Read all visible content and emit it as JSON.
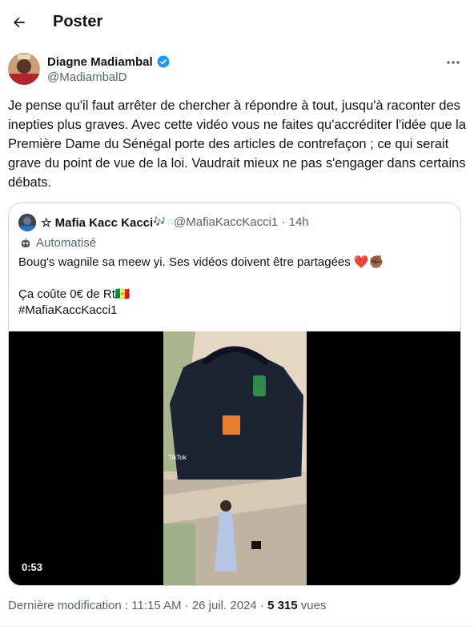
{
  "header": {
    "title": "Poster",
    "back_icon": "arrow-left-icon"
  },
  "tweet": {
    "author": {
      "name": "Diagne Madiambal",
      "handle": "@MadiambalD",
      "verified_color": "#1d9bf0"
    },
    "text": "Je pense qu'il faut arrêter de chercher à répondre à tout, jusqu'à raconter des inepties plus graves.  Avec cette vidéo vous ne faites qu'accréditer l'idée que la Première Dame du Sénégal porte des articles de contrefaçon ; ce qui serait grave du point de vue de la loi. Vaudrait mieux ne pas s'engager dans certains débats.",
    "meta": {
      "prefix": "Dernière modification : 11:15 AM · 26 juil. 2024 · ",
      "views_count": "5 315",
      "views_label": " vues"
    }
  },
  "quote": {
    "author_name": "☆ Mafia Kacc Kacci",
    "author_symbols": "🎶☆",
    "handle_time": "@MafiaKaccKacci1 · 14h",
    "automated_label": "Automatisé",
    "line1": "Boug's wagnile sa meew yi. Ses vidéos doivent être partagées ❤️✊🏾",
    "line2": "Ça coûte 0€ de Rt🇸🇳",
    "line3": "#MafiaKaccKacci1",
    "video": {
      "duration": "0:53",
      "watermark": "TikTok"
    }
  },
  "colors": {
    "text": "#0f1419",
    "secondary": "#536471",
    "border": "#cfd9de",
    "accent": "#1d9bf0"
  }
}
